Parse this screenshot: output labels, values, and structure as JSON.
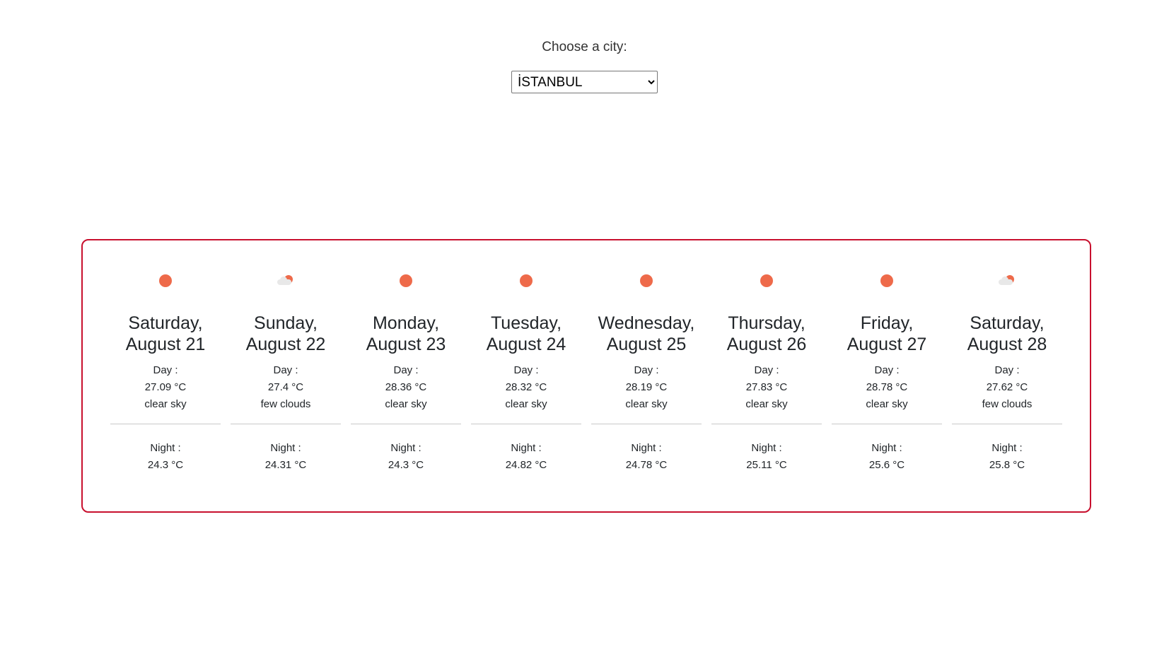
{
  "city_chooser": {
    "label": "Choose a city:",
    "selected": "İSTANBUL"
  },
  "colors": {
    "panel_border": "#c8102e",
    "sun": "#ee6a4a",
    "cloud": "#e8e8e8"
  },
  "days": [
    {
      "icon": "sun-icon",
      "weekday": "Saturday,",
      "date": "August 21",
      "day_label": "Day :",
      "day_temp": "27.09 °C",
      "desc": "clear sky",
      "night_label": "Night :",
      "night_temp": "24.3 °C"
    },
    {
      "icon": "few-clouds-icon",
      "weekday": "Sunday,",
      "date": "August 22",
      "day_label": "Day :",
      "day_temp": "27.4 °C",
      "desc": "few clouds",
      "night_label": "Night :",
      "night_temp": "24.31 °C"
    },
    {
      "icon": "sun-icon",
      "weekday": "Monday,",
      "date": "August 23",
      "day_label": "Day :",
      "day_temp": "28.36 °C",
      "desc": "clear sky",
      "night_label": "Night :",
      "night_temp": "24.3 °C"
    },
    {
      "icon": "sun-icon",
      "weekday": "Tuesday,",
      "date": "August 24",
      "day_label": "Day :",
      "day_temp": "28.32 °C",
      "desc": "clear sky",
      "night_label": "Night :",
      "night_temp": "24.82 °C"
    },
    {
      "icon": "sun-icon",
      "weekday": "Wednesday,",
      "date": "August 25",
      "day_label": "Day :",
      "day_temp": "28.19 °C",
      "desc": "clear sky",
      "night_label": "Night :",
      "night_temp": "24.78 °C"
    },
    {
      "icon": "sun-icon",
      "weekday": "Thursday,",
      "date": "August 26",
      "day_label": "Day :",
      "day_temp": "27.83 °C",
      "desc": "clear sky",
      "night_label": "Night :",
      "night_temp": "25.11 °C"
    },
    {
      "icon": "sun-icon",
      "weekday": "Friday,",
      "date": "August 27",
      "day_label": "Day :",
      "day_temp": "28.78 °C",
      "desc": "clear sky",
      "night_label": "Night :",
      "night_temp": "25.6 °C"
    },
    {
      "icon": "few-clouds-icon",
      "weekday": "Saturday,",
      "date": "August 28",
      "day_label": "Day :",
      "day_temp": "27.62 °C",
      "desc": "few clouds",
      "night_label": "Night :",
      "night_temp": "25.8 °C"
    }
  ]
}
